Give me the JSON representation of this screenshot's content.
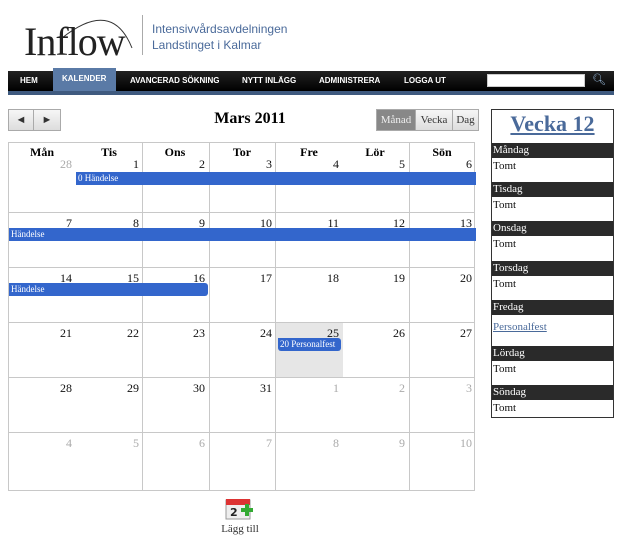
{
  "header": {
    "logo": "Inflow",
    "org_line1": "Intensivvårdsavdelningen",
    "org_line2": "Landstinget i Kalmar"
  },
  "nav": {
    "items": [
      "HEM",
      "KALENDER",
      "AVANCERAD SÖKNING",
      "NYTT INLÄGG",
      "ADMINISTRERA",
      "LOGGA UT"
    ],
    "active": "KALENDER",
    "search_value": ""
  },
  "toolbar": {
    "prev": "◄",
    "next": "►",
    "title": "Mars 2011",
    "views": [
      "Månad",
      "Vecka",
      "Dag"
    ],
    "active_view": "Månad"
  },
  "calendar": {
    "weekdays": [
      "Mån",
      "Tis",
      "Ons",
      "Tor",
      "Fre",
      "Lör",
      "Sön"
    ],
    "weeks": [
      [
        {
          "n": "28",
          "o": true
        },
        {
          "n": "1"
        },
        {
          "n": "2"
        },
        {
          "n": "3"
        },
        {
          "n": "4"
        },
        {
          "n": "5"
        },
        {
          "n": "6"
        }
      ],
      [
        {
          "n": "7"
        },
        {
          "n": "8"
        },
        {
          "n": "9"
        },
        {
          "n": "10"
        },
        {
          "n": "11"
        },
        {
          "n": "12"
        },
        {
          "n": "13"
        }
      ],
      [
        {
          "n": "14"
        },
        {
          "n": "15"
        },
        {
          "n": "16"
        },
        {
          "n": "17"
        },
        {
          "n": "18"
        },
        {
          "n": "19"
        },
        {
          "n": "20"
        }
      ],
      [
        {
          "n": "21"
        },
        {
          "n": "22"
        },
        {
          "n": "23"
        },
        {
          "n": "24"
        },
        {
          "n": "25",
          "today": true
        },
        {
          "n": "26"
        },
        {
          "n": "27"
        }
      ],
      [
        {
          "n": "28"
        },
        {
          "n": "29"
        },
        {
          "n": "30"
        },
        {
          "n": "31"
        },
        {
          "n": "1",
          "o": true
        },
        {
          "n": "2",
          "o": true
        },
        {
          "n": "3",
          "o": true
        }
      ],
      [
        {
          "n": "4",
          "o": true
        },
        {
          "n": "5",
          "o": true
        },
        {
          "n": "6",
          "o": true
        },
        {
          "n": "7",
          "o": true
        },
        {
          "n": "8",
          "o": true
        },
        {
          "n": "9",
          "o": true
        },
        {
          "n": "10",
          "o": true
        }
      ]
    ],
    "events": [
      {
        "label": "0 Händelse",
        "week": 0,
        "start": 1,
        "end": 6,
        "continues": true
      },
      {
        "label": "Händelse",
        "week": 1,
        "start": 0,
        "end": 6,
        "continues": true
      },
      {
        "label": "Händelse",
        "week": 2,
        "start": 0,
        "end": 2
      },
      {
        "label": "20 Personalfest",
        "week": 3,
        "start": 4,
        "end": 4
      }
    ],
    "event_color": "#3366cc"
  },
  "sidebar": {
    "title": "Vecka 12",
    "days": [
      {
        "day": "Måndag",
        "text": "Tomt"
      },
      {
        "day": "Tisdag",
        "text": "Tomt"
      },
      {
        "day": "Onsdag",
        "text": "Tomt"
      },
      {
        "day": "Torsdag",
        "text": "Tomt"
      },
      {
        "day": "Fredag",
        "text": "Personalfest",
        "link": true
      },
      {
        "day": "Lördag",
        "text": "Tomt"
      },
      {
        "day": "Söndag",
        "text": "Tomt"
      }
    ]
  },
  "add": {
    "label": "Lägg till",
    "icon": "calendar-add-icon"
  }
}
